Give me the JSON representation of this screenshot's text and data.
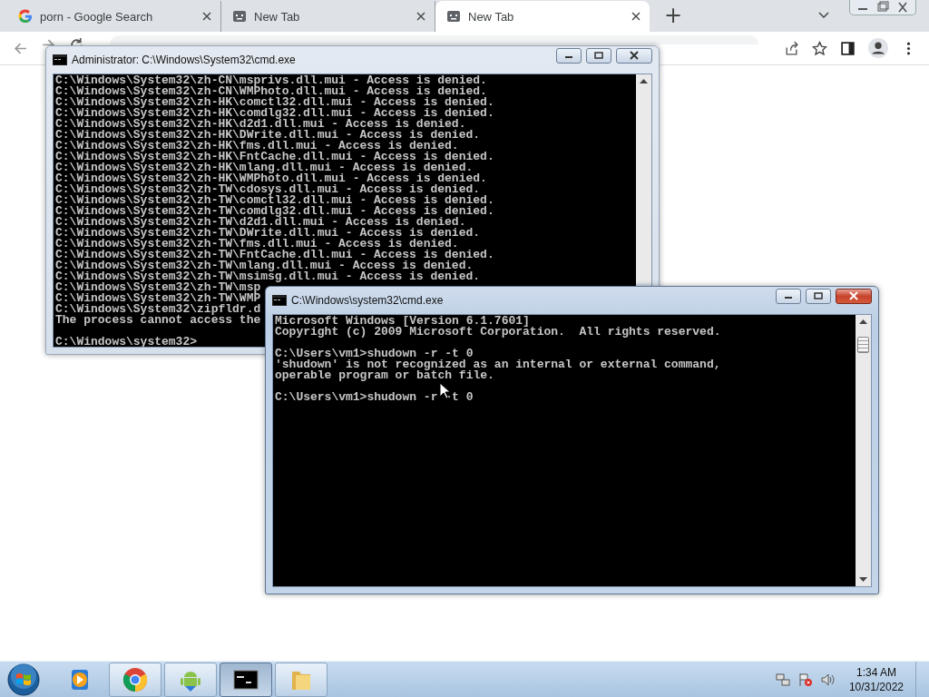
{
  "browser": {
    "tabs": [
      {
        "title": "porn - Google Search",
        "kind": "google",
        "selected": false
      },
      {
        "title": "New Tab",
        "kind": "page",
        "selected": false
      },
      {
        "title": "New Tab",
        "kind": "page",
        "selected": true
      }
    ],
    "new_tab_button": "+"
  },
  "console_windows": [
    {
      "title": "Administrator: C:\\Windows\\System32\\cmd.exe",
      "active": false,
      "blocks": [
        [
          "C:\\Windows\\System32\\zh-CN\\msprivs.dll.mui - Access is denied.",
          "C:\\Windows\\System32\\zh-CN\\WMPhoto.dll.mui - Access is denied.",
          "C:\\Windows\\System32\\zh-HK\\comctl32.dll.mui - Access is denied.",
          "C:\\Windows\\System32\\zh-HK\\comdlg32.dll.mui - Access is denied.",
          "C:\\Windows\\System32\\zh-HK\\d2d1.dll.mui - Access is denied.",
          "C:\\Windows\\System32\\zh-HK\\DWrite.dll.mui - Access is denied.",
          "C:\\Windows\\System32\\zh-HK\\fms.dll.mui - Access is denied.",
          "C:\\Windows\\System32\\zh-HK\\FntCache.dll.mui - Access is denied.",
          "C:\\Windows\\System32\\zh-HK\\mlang.dll.mui - Access is denied.",
          "C:\\Windows\\System32\\zh-HK\\WMPhoto.dll.mui - Access is denied.",
          "C:\\Windows\\System32\\zh-TW\\cdosys.dll.mui - Access is denied.",
          "C:\\Windows\\System32\\zh-TW\\comctl32.dll.mui - Access is denied.",
          "C:\\Windows\\System32\\zh-TW\\comdlg32.dll.mui - Access is denied.",
          "C:\\Windows\\System32\\zh-TW\\d2d1.dll.mui - Access is denied.",
          "C:\\Windows\\System32\\zh-TW\\DWrite.dll.mui - Access is denied.",
          "C:\\Windows\\System32\\zh-TW\\fms.dll.mui - Access is denied.",
          "C:\\Windows\\System32\\zh-TW\\FntCache.dll.mui - Access is denied.",
          "C:\\Windows\\System32\\zh-TW\\mlang.dll.mui - Access is denied.",
          "C:\\Windows\\System32\\zh-TW\\msimsg.dll.mui - Access is denied.",
          "C:\\Windows\\System32\\zh-TW\\msp",
          "C:\\Windows\\System32\\zh-TW\\WMP",
          "C:\\Windows\\System32\\zipfldr.d",
          "The process cannot access the"
        ],
        [
          "C:\\Windows\\system32>"
        ]
      ]
    },
    {
      "title": "C:\\Windows\\system32\\cmd.exe",
      "active": true,
      "blocks": [
        [
          "Microsoft Windows [Version 6.1.7601]",
          "Copyright (c) 2009 Microsoft Corporation.  All rights reserved."
        ],
        [
          "C:\\Users\\vm1>shudown -r -t 0",
          "'shudown' is not recognized as an internal or external command,",
          "operable program or batch file."
        ],
        [
          "C:\\Users\\vm1>shudown -r -t 0"
        ]
      ]
    }
  ],
  "taskbar": {
    "items": [
      {
        "kind": "media",
        "running": false,
        "selected": false
      },
      {
        "kind": "chrome",
        "running": true,
        "selected": false
      },
      {
        "kind": "android",
        "running": true,
        "selected": false
      },
      {
        "kind": "console",
        "running": true,
        "selected": true
      },
      {
        "kind": "folder",
        "running": true,
        "selected": false
      }
    ],
    "clock": {
      "time": "1:34 AM",
      "date": "10/31/2022"
    }
  }
}
